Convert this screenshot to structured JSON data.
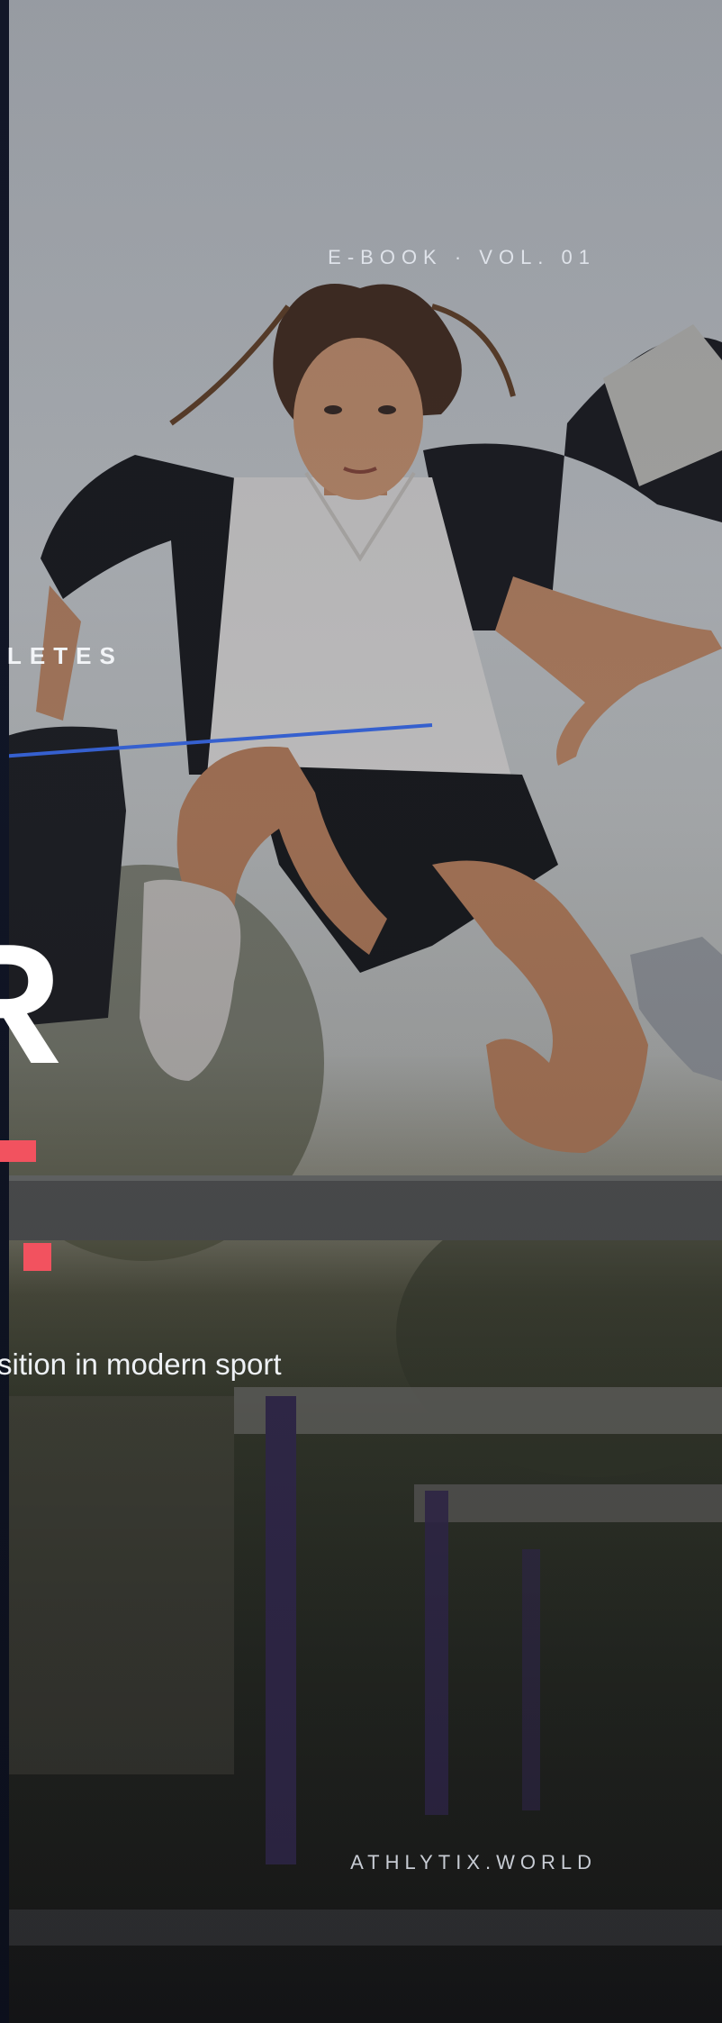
{
  "cover": {
    "edition": "E-BOOK · VOL. 01",
    "kicker": "LETES",
    "big_letter": "R",
    "subtitle": "sition in modern sport",
    "site": "ATHLYTIX.WORLD"
  },
  "colors": {
    "accent": "#f2525f",
    "line": "#3f74ff",
    "left_band": "#111628",
    "text": "#ffffff"
  }
}
